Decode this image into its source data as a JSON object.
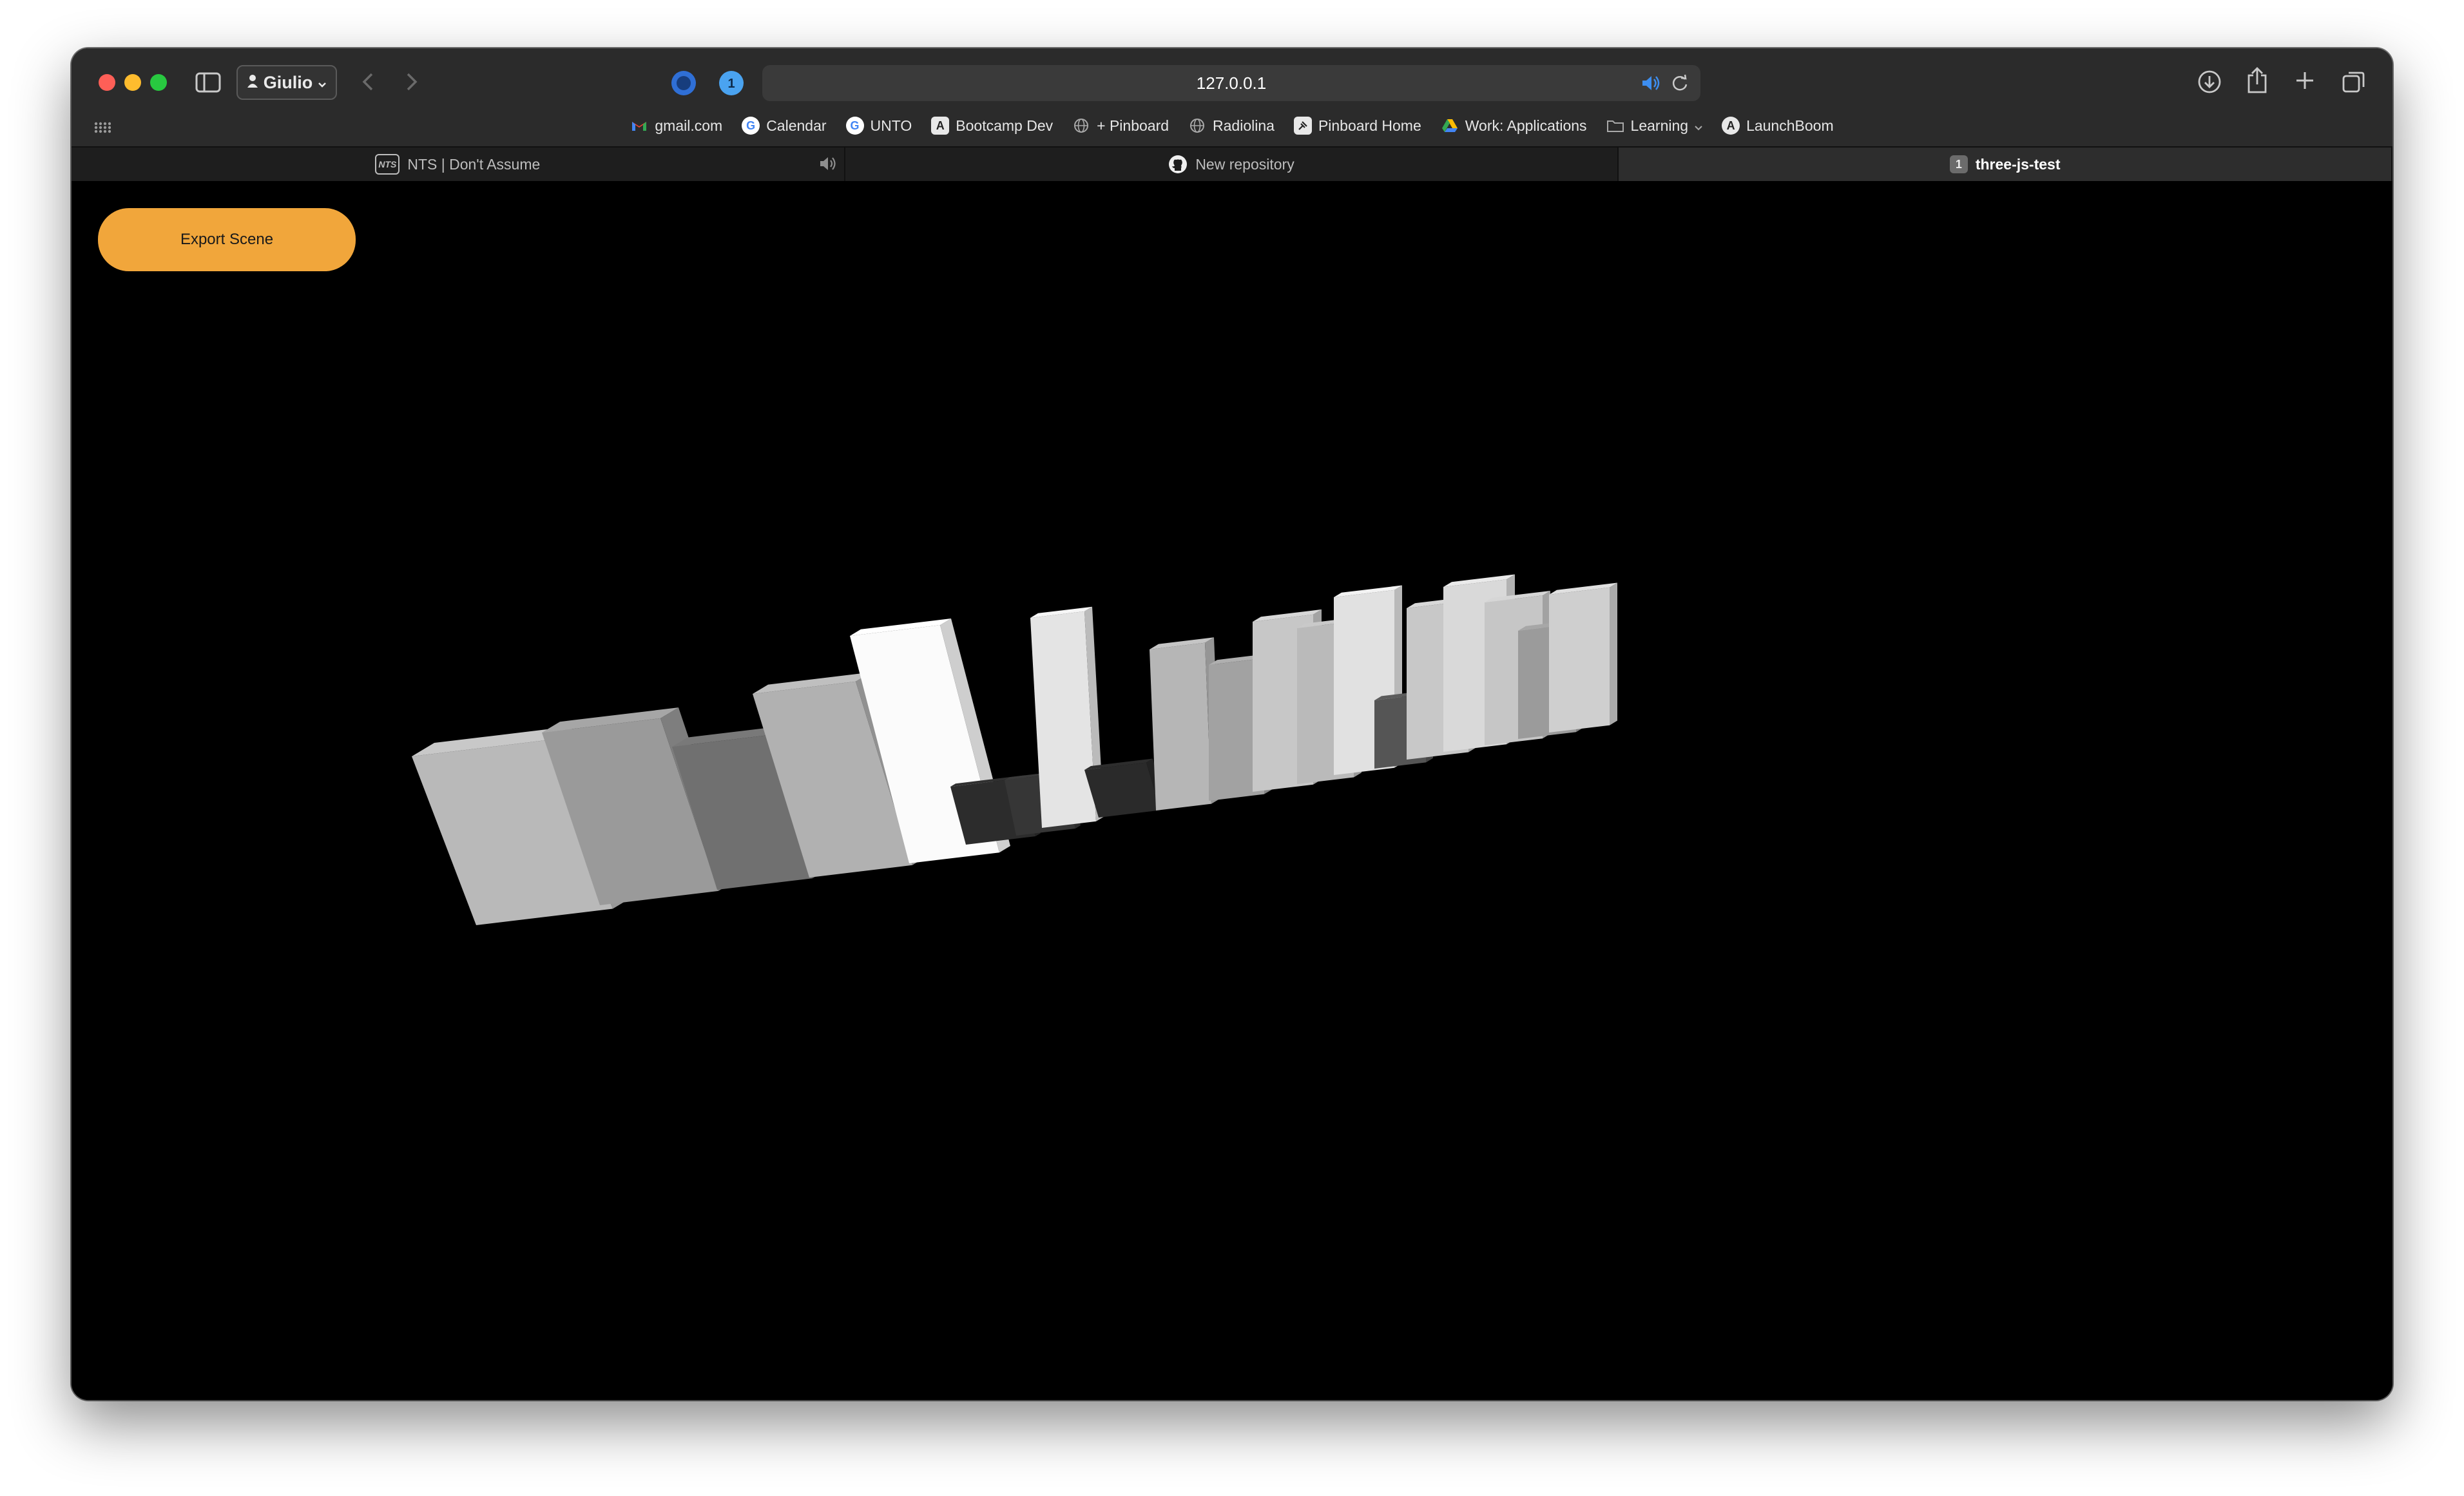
{
  "browser": {
    "profile_name": "Giulio",
    "address": "127.0.0.1",
    "bookmarks": [
      {
        "label": "gmail.com",
        "icon": "gmail-icon"
      },
      {
        "label": "Calendar",
        "icon": "google-icon"
      },
      {
        "label": "UNTO",
        "icon": "google-icon"
      },
      {
        "label": "Bootcamp Dev",
        "icon": "bootcamp-icon"
      },
      {
        "label": "+ Pinboard",
        "icon": "globe-icon"
      },
      {
        "label": "Radiolina",
        "icon": "globe-icon"
      },
      {
        "label": "Pinboard Home",
        "icon": "pin-icon"
      },
      {
        "label": "Work: Applications",
        "icon": "drive-icon"
      },
      {
        "label": "Learning",
        "icon": "folder-icon"
      },
      {
        "label": "LaunchBoom",
        "icon": "launchboom-icon"
      }
    ],
    "tabs": [
      {
        "label": "NTS | Don't Assume",
        "icon_text": "NTS",
        "active": false
      },
      {
        "label": "New repository",
        "icon_text": "",
        "active": false
      },
      {
        "label": "three-js-test",
        "icon_text": "1",
        "active": true
      }
    ]
  },
  "page": {
    "export_button": "Export Scene"
  },
  "scene": {
    "bar_gray_levels": [
      "#b9b9b9",
      "#9a9a9a",
      "#707070",
      "#b1b1b1",
      "#fbfbfb",
      "#2c2c2c",
      "#363636",
      "#e4e4e4",
      "#2a2a2a",
      "#b6b6b6",
      "#a2a2a2",
      "#c7c7c7",
      "#bababa",
      "#e1e1e1",
      "#555555",
      "#c8c8c8",
      "#d9d9d9",
      "#c6c6c6",
      "#9b9b9b",
      "#cfcfcf"
    ]
  }
}
